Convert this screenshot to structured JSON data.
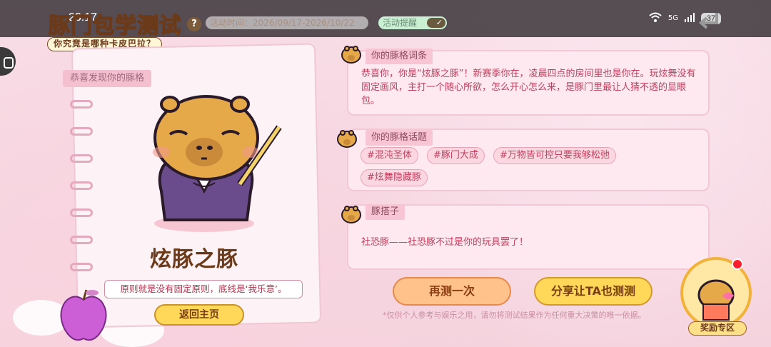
{
  "status_bar": {
    "time": "23:17",
    "network": "5G",
    "battery": "37"
  },
  "header": {
    "title": "豚门包学测试",
    "subtitle": "你究竟是哪种卡皮巴拉？",
    "period": "活动时间：2026/09/17-2026/10/22",
    "remind_label": "活动提醒"
  },
  "result_card": {
    "ribbon_label": "恭喜发现你的豚格",
    "result_name": "炫豚之豚",
    "motto": "原则就是没有固定原则，底线是‘我乐意’。",
    "home_button": "返回主页"
  },
  "panels": {
    "quote": {
      "title": "你的豚格词条",
      "text": "恭喜你，你是“炫豚之豚”！新赛季你在，凌晨四点的房间里也是你在。玩炫舞没有固定画风，主打一个随心所欲，怎么开心怎么来，是豚门里最让人猜不透的显眼包。"
    },
    "topics": {
      "title": "你的豚格话题",
      "tags": [
        "#混沌圣体",
        "#豚门大成",
        "#万物皆可控只要我够松弛",
        "#炫舞隐藏豚"
      ]
    },
    "partner": {
      "title": "豚搭子",
      "text": "社恐豚——社恐豚不过是你的玩具罢了！"
    }
  },
  "actions": {
    "retry": "再测一次",
    "share": "分享让TA也测测",
    "disclaimer": "*仅供个人参考与娱乐之用，请勿将测试结果作为任何重大决策的唯一依据。"
  },
  "reward": {
    "label": "奖励专区"
  },
  "icons": [
    "back-arrow-icon",
    "help-icon",
    "wifi-icon",
    "signal-icon",
    "battery-icon",
    "capybara-icon",
    "apple-icon",
    "gift-icon"
  ]
}
